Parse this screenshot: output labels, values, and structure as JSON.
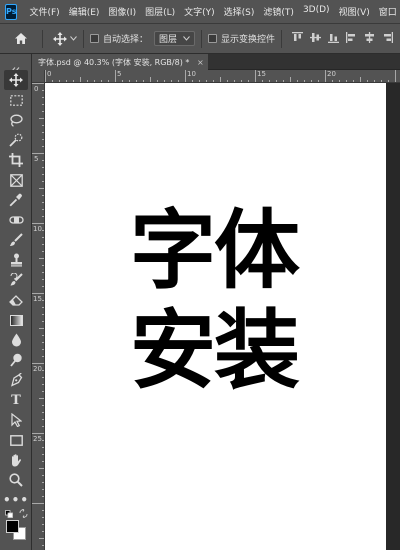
{
  "app": {
    "logo_text": "Ps"
  },
  "menu": {
    "items": [
      "文件(F)",
      "编辑(E)",
      "图像(I)",
      "图层(L)",
      "文字(Y)",
      "选择(S)",
      "滤镜(T)",
      "3D(D)",
      "视图(V)",
      "窗口"
    ]
  },
  "options": {
    "auto_select_label": "自动选择：",
    "layer_select_value": "图层",
    "show_transform_label": "显示变换控件"
  },
  "document": {
    "tab_title": "字体.psd @ 40.3% (字体 安装, RGB/8) *",
    "close_glyph": "×"
  },
  "rulers": {
    "top_labels": [
      "0",
      "5",
      "10",
      "15",
      "20"
    ],
    "left_labels": [
      "0",
      "5",
      "10",
      "15",
      "20",
      "25"
    ]
  },
  "canvas": {
    "line1": "字体",
    "line2": "安装"
  },
  "tools": {
    "type_label": "T",
    "more_label": "•••"
  },
  "colors": {
    "ui_panel": "#535353",
    "ui_dark": "#282828",
    "foreground_color": "#000000",
    "background_color": "#ffffff"
  }
}
